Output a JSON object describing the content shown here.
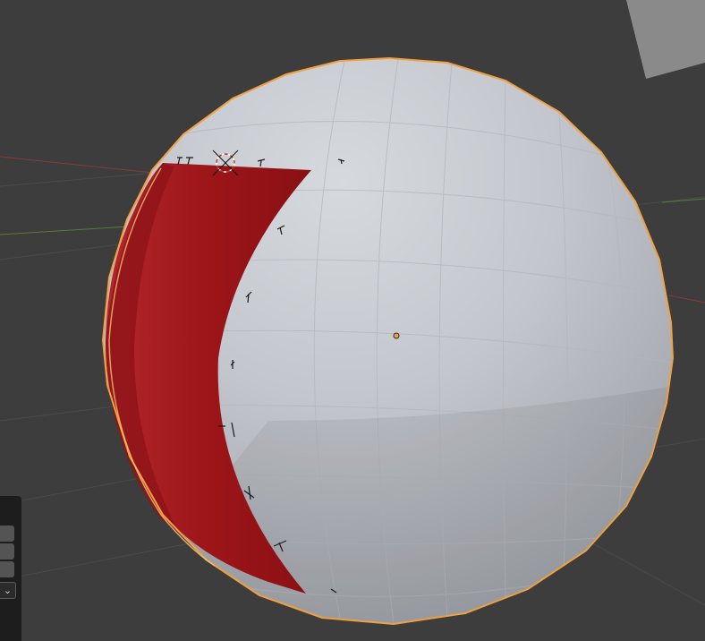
{
  "viewport": {
    "background": "#3d3d3d",
    "grid_color": "#4a4a4a",
    "axis_x_color": "#8a3a3a",
    "axis_y_color": "#5a7a3a"
  },
  "objects": {
    "sphere": {
      "name": "sphere",
      "selected": true,
      "outline_color": "#f0a040",
      "shade": "#c2c5cb"
    },
    "patch": {
      "name": "red-patch",
      "color": "#a11a1f"
    },
    "origin": {
      "color": "#f0a040"
    }
  },
  "side_panel": {
    "dropdown_icon": "chevron-down-icon",
    "dropdown_glyph": "⌄"
  }
}
